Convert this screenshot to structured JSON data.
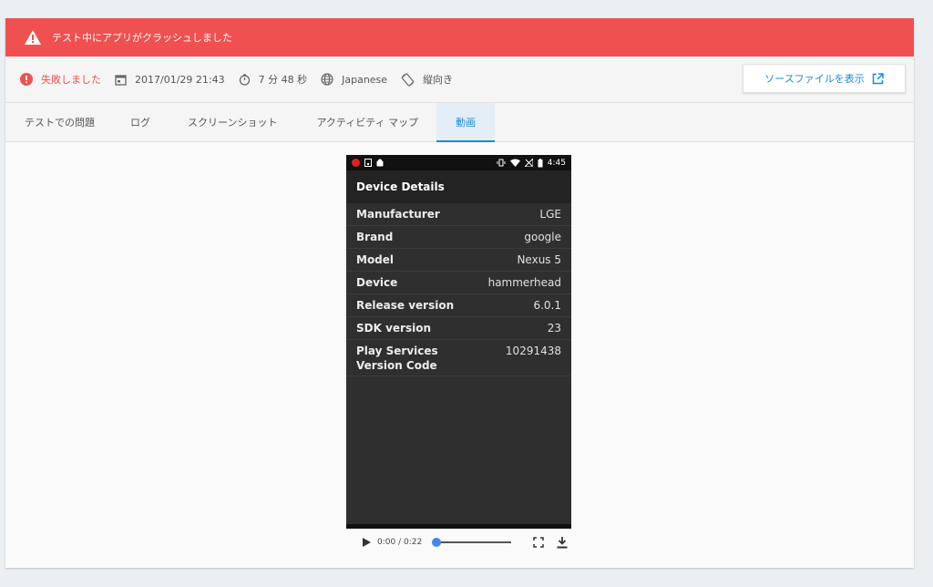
{
  "banner": {
    "message": "テスト中にアプリがクラッシュしました"
  },
  "meta": {
    "status": "失敗しました",
    "datetime": "2017/01/29 21:43",
    "duration": "7 分 48 秒",
    "locale": "Japanese",
    "orientation": "縦向き",
    "source_button": "ソースファイルを表示"
  },
  "tabs": [
    {
      "label": "テストでの問題"
    },
    {
      "label": "ログ"
    },
    {
      "label": "スクリーンショット"
    },
    {
      "label": "アクティビティ マップ"
    },
    {
      "label": "動画"
    }
  ],
  "device": {
    "status_time": "4:45",
    "title": "Device Details",
    "rows": [
      {
        "k": "Manufacturer",
        "v": "LGE"
      },
      {
        "k": "Brand",
        "v": "google"
      },
      {
        "k": "Model",
        "v": "Nexus 5"
      },
      {
        "k": "Device",
        "v": "hammerhead"
      },
      {
        "k": "Release version",
        "v": "6.0.1"
      },
      {
        "k": "SDK version",
        "v": "23"
      },
      {
        "k": "Play Services Version Code",
        "v": "10291438"
      }
    ]
  },
  "player": {
    "time": "0:00 / 0:22",
    "progress": 0
  },
  "colors": {
    "error": "#f05050",
    "accent": "#1a8bd6",
    "knob": "#4285f4"
  }
}
